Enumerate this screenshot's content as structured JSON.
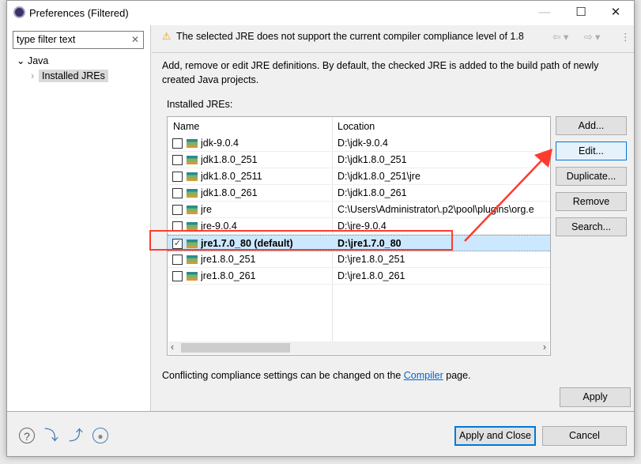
{
  "window": {
    "title": "Preferences (Filtered)",
    "minimize": "—",
    "maximize": "☐",
    "close": "✕"
  },
  "sidebar": {
    "filter_value": "type filter text",
    "clear": "✕",
    "tree": [
      {
        "label": "Java",
        "expanded": true
      },
      {
        "label": "Installed JREs",
        "selected": true
      }
    ]
  },
  "header": {
    "warning": "The selected JRE does not support the current compiler compliance level of 1.8",
    "back": "⇦ ▾",
    "forward": "⇨ ▾",
    "menu": "⋮"
  },
  "description": "Add, remove or edit JRE definitions. By default, the checked JRE is added to the build path of newly created Java projects.",
  "table": {
    "label": "Installed JREs:",
    "columns": [
      "Name",
      "Location"
    ],
    "rows": [
      {
        "name": "jdk-9.0.4",
        "location": "D:\\jdk-9.0.4",
        "checked": false
      },
      {
        "name": "jdk1.8.0_251",
        "location": "D:\\jdk1.8.0_251",
        "checked": false
      },
      {
        "name": "jdk1.8.0_2511",
        "location": "D:\\jdk1.8.0_251\\jre",
        "checked": false
      },
      {
        "name": "jdk1.8.0_261",
        "location": "D:\\jdk1.8.0_261",
        "checked": false
      },
      {
        "name": "jre",
        "location": "C:\\Users\\Administrator\\.p2\\pool\\plugins\\org.e",
        "checked": false
      },
      {
        "name": "jre-9.0.4",
        "location": "D:\\jre-9.0.4",
        "checked": false
      },
      {
        "name": "jre1.7.0_80 (default)",
        "location": "D:\\jre1.7.0_80",
        "checked": true
      },
      {
        "name": "jre1.8.0_251",
        "location": "D:\\jre1.8.0_251",
        "checked": false
      },
      {
        "name": "jre1.8.0_261",
        "location": "D:\\jre1.8.0_261",
        "checked": false
      }
    ]
  },
  "buttons": {
    "add": "Add...",
    "edit": "Edit...",
    "duplicate": "Duplicate...",
    "remove": "Remove",
    "search": "Search..."
  },
  "footer": {
    "conflict_prefix": "Conflicting compliance settings can be changed on the ",
    "conflict_link": "Compiler",
    "conflict_suffix": " page.",
    "apply": "Apply",
    "apply_close": "Apply and Close",
    "cancel": "Cancel"
  },
  "annotation_color": "#ff3b30"
}
